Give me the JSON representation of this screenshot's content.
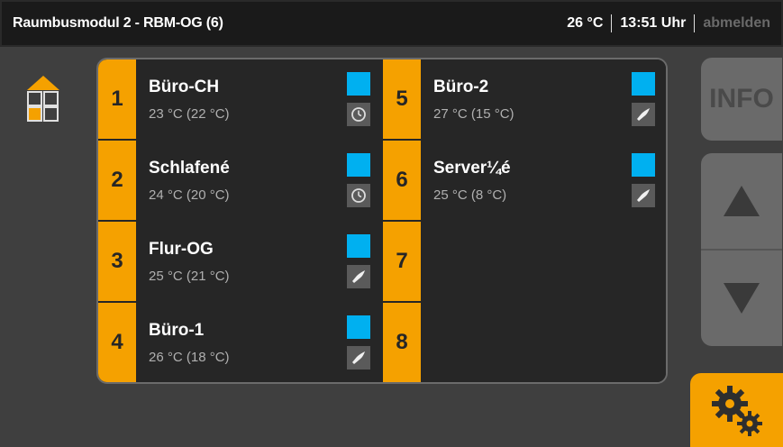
{
  "header": {
    "title": "Raumbusmodul 2 - RBM-OG (6)",
    "temperature": "26 °C",
    "time": "13:51 Uhr",
    "logout": "abmelden"
  },
  "rooms": [
    {
      "number": "1",
      "name": "Büro-CH",
      "temp": "23 °C (22 °C)",
      "indicator_color": "#00b0f0",
      "mode_icon": "clock-icon"
    },
    {
      "number": "5",
      "name": "Büro-2",
      "temp": "27 °C (15 °C)",
      "indicator_color": "#00b0f0",
      "mode_icon": "hand-icon"
    },
    {
      "number": "2",
      "name": "Schlafené",
      "temp": "24 °C (20 °C)",
      "indicator_color": "#00b0f0",
      "mode_icon": "clock-icon"
    },
    {
      "number": "6",
      "name": "Server¼é",
      "temp": "25 °C (8 °C)",
      "indicator_color": "#00b0f0",
      "mode_icon": "hand-icon"
    },
    {
      "number": "3",
      "name": "Flur-OG",
      "temp": "25 °C (21 °C)",
      "indicator_color": "#00b0f0",
      "mode_icon": "hand-icon"
    },
    {
      "number": "7",
      "name": "",
      "temp": "",
      "indicator_color": "",
      "mode_icon": ""
    },
    {
      "number": "4",
      "name": "Büro-1",
      "temp": "26 °C (18 °C)",
      "indicator_color": "#00b0f0",
      "mode_icon": "hand-icon"
    },
    {
      "number": "8",
      "name": "",
      "temp": "",
      "indicator_color": "",
      "mode_icon": ""
    }
  ],
  "side": {
    "info_label": "INFO",
    "up_icon": "arrow-up-icon",
    "down_icon": "arrow-down-icon",
    "settings_icon": "gears-icon"
  },
  "colors": {
    "accent": "#f5a100",
    "indicator": "#00b0f0",
    "background": "#3f3f3f"
  }
}
